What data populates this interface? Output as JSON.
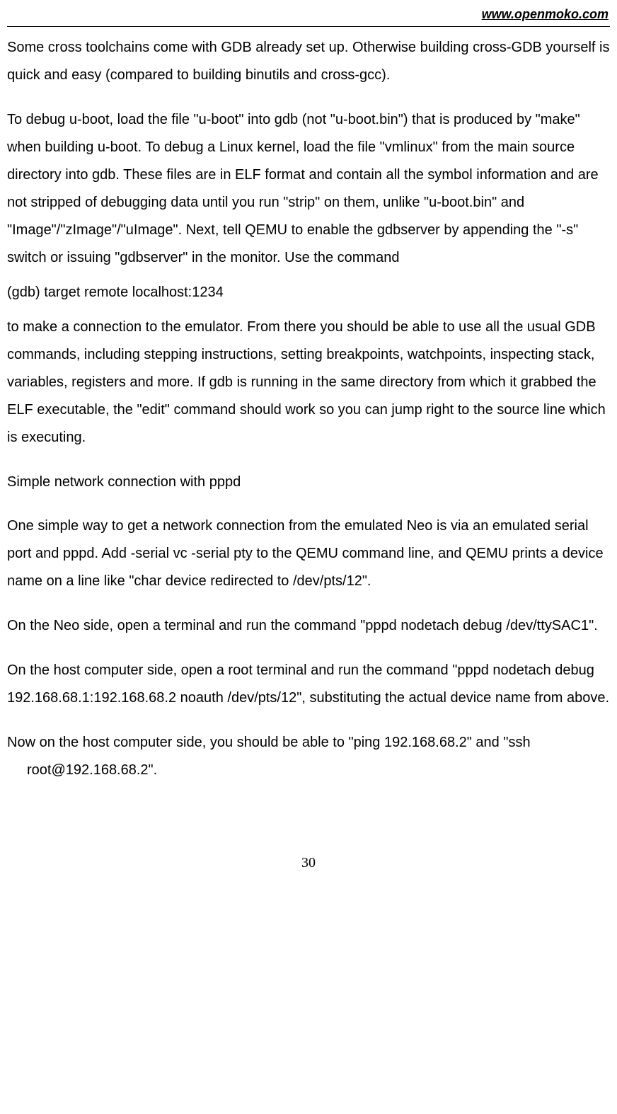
{
  "header": {
    "url_text": "www.openmoko.com"
  },
  "paragraphs": {
    "p1": "Some cross toolchains come with GDB already set up. Otherwise building cross-GDB yourself is quick and easy (compared to building binutils and cross-gcc).",
    "p2": "To debug u-boot, load the file \"u-boot\" into gdb (not \"u-boot.bin\") that is produced by \"make\" when building u-boot. To debug a Linux kernel, load the file \"vmlinux\" from the main source directory into gdb. These files are in ELF format and contain all the symbol information and are not stripped of debugging data until you run \"strip\" on them, unlike \"u-boot.bin\" and \"Image\"/\"zImage\"/\"uImage\". Next, tell QEMU to enable the gdbserver by appending the \"-s\" switch or issuing \"gdbserver\" in the monitor. Use the command",
    "gdb_command": "(gdb) target remote localhost:1234",
    "p3": "to make a connection to the emulator. From there you should be able to use all the usual GDB commands, including stepping instructions, setting breakpoints, watchpoints, inspecting stack, variables, registers and more. If gdb is running in the same directory from which it grabbed the ELF executable, the \"edit\" command should work so you can jump right to the source line which is executing.",
    "heading": "Simple network connection with pppd",
    "p4": "One simple way to get a network connection from the emulated Neo is via an emulated serial port and pppd. Add -serial vc -serial pty to the QEMU command line, and QEMU prints a device name on a line like \"char device redirected to /dev/pts/12\".",
    "p5": "On the Neo side, open a terminal and run the command \"pppd nodetach debug /dev/ttySAC1\".",
    "p6": "On the host computer side, open a root terminal and run the command \"pppd nodetach debug 192.168.68.1:192.168.68.2 noauth /dev/pts/12\", substituting the actual device name from above.",
    "p7": "Now on the host computer side, you should be able to \"ping 192.168.68.2\" and \"ssh root@192.168.68.2\"."
  },
  "footer": {
    "page_number": "30"
  }
}
